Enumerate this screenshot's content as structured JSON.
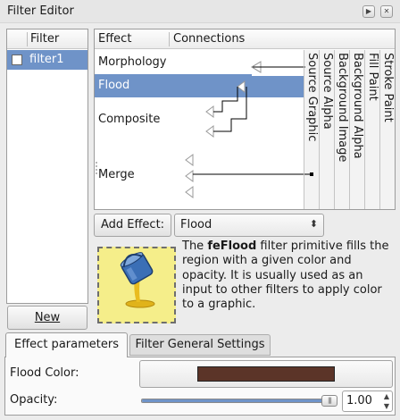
{
  "window": {
    "title": "Filter Editor"
  },
  "filter_list": {
    "header": "Filter",
    "items": [
      {
        "name": "filter1",
        "checked": false,
        "selected": true
      }
    ],
    "new_button": "New"
  },
  "effect_list": {
    "header_effect": "Effect",
    "header_connections": "Connections",
    "effects": [
      "Morphology",
      "Flood",
      "Composite",
      "Merge"
    ],
    "selected_effect": "Flood",
    "inputs": [
      "Source Graphic",
      "Source Alpha",
      "Background Image",
      "Background Alpha",
      "Fill Paint",
      "Stroke Paint"
    ]
  },
  "add_effect": {
    "button_label": "Add Effect:",
    "selected": "Flood"
  },
  "description": {
    "primitive": "feFlood",
    "before": "The ",
    "after": " filter primitive fills the region with a given color and opacity.  It is usually used as an input to other filters to apply color to a graphic."
  },
  "tabs": [
    {
      "label": "Effect parameters",
      "active": true
    },
    {
      "label": "Filter General Settings",
      "active": false
    }
  ],
  "params": {
    "flood_color_label": "Flood Color:",
    "flood_color": "#5b3428",
    "opacity_label": "Opacity:",
    "opacity_value": "1.00",
    "opacity_fraction": 1.0
  },
  "colors": {
    "selection": "#6f93c8",
    "icon_background": "#f5ee8a"
  }
}
